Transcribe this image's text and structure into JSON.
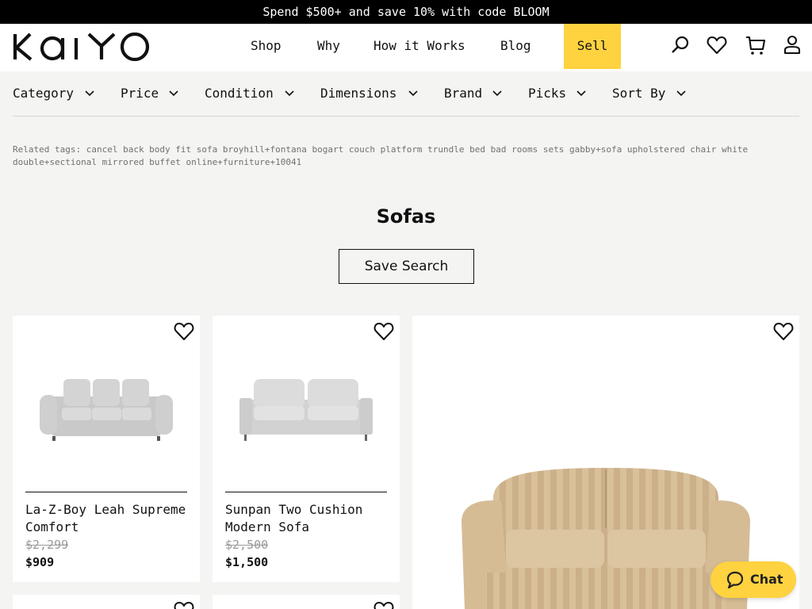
{
  "promo_bar": {
    "text": "Spend $500+ and save 10% with code BLOOM"
  },
  "brand": {
    "logo_text": "KAIYO"
  },
  "nav": {
    "items": [
      "Shop",
      "Why",
      "How it Works",
      "Blog"
    ],
    "sell_label": "Sell"
  },
  "header_icons": [
    "search-icon",
    "heart-icon",
    "cart-icon",
    "user-icon"
  ],
  "filters": [
    "Category",
    "Price",
    "Condition",
    "Dimensions",
    "Brand",
    "Picks",
    "Sort By"
  ],
  "related_tags": "Related tags: cancel back body fit sofa broyhill+fontana bogart couch platform trundle bed bad rooms sets gabby+sofa upholstered chair white double+sectional mirrored buffet online+furniture+10041",
  "page": {
    "title": "Sofas",
    "save_search_label": "Save Search"
  },
  "products": [
    {
      "name": "La-Z-Boy Leah Supreme Comfort",
      "original_price": "$2,299",
      "sale_price": "$909"
    },
    {
      "name": "Sunpan Two Cushion Modern Sofa",
      "original_price": "$2,500",
      "sale_price": "$1,500"
    }
  ],
  "colors": {
    "accent": "#ffd23f",
    "promo_bg": "#000000",
    "page_bg": "#f4f4f2"
  },
  "chat": {
    "label": "Chat"
  }
}
